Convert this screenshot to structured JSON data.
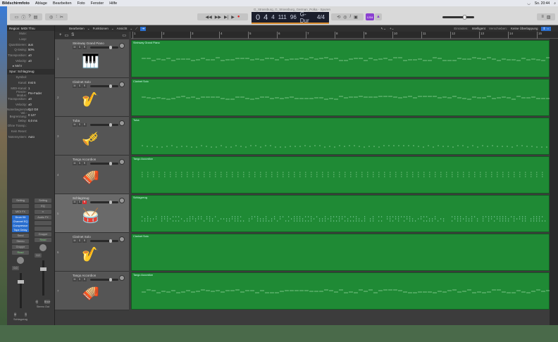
{
  "menubar": {
    "app": "Bildschirmfoto",
    "items": [
      "Ablage",
      "Bearbeiten",
      "Foto",
      "Fenster",
      "Hilfe"
    ],
    "clock": "So. 20:44"
  },
  "window": {
    "title": "G_Strassburg_G_Strassburg_German_Polka - Spuren"
  },
  "lcd": {
    "bar": "0",
    "beat": "4",
    "div": "4",
    "tick": "111",
    "tempo": "96",
    "key": "G-Dur",
    "sig": "4/4"
  },
  "count_in": "1234",
  "control_bar": {
    "edit": "Bearbeiten",
    "functions": "Funktionen",
    "view": "Ansicht",
    "snap_label": "Einrasten:",
    "snap_value": "Intelligent",
    "drag_label": "Verschieben:",
    "drag_value": "Keine Überlappung"
  },
  "ruler": [
    "1",
    "2",
    "3",
    "4",
    "5",
    "6",
    "7",
    "8",
    "9",
    "10",
    "11",
    "12",
    "13",
    "14",
    "15"
  ],
  "inspector": {
    "region_header": "Region: MIDI Thru",
    "region_rows": [
      [
        "Mute:",
        ""
      ],
      [
        "Loop:",
        ""
      ],
      [
        "Quantisieren:",
        "aus"
      ],
      [
        "Q-Swing:",
        "50%"
      ],
      [
        "Transposition:",
        "±0"
      ],
      [
        "Velocity:",
        "±0"
      ]
    ],
    "more": "▸ Mehr",
    "track_header": "Spur: Schlagzeug",
    "track_rows": [
      [
        "Symbol:",
        ""
      ],
      [
        "Kanal:",
        "Inst 5"
      ],
      [
        "MIDI-Kanal:",
        "1"
      ],
      [
        "Freeze-Modus:",
        "Pre-Fader"
      ],
      [
        "Transposition:",
        "±0"
      ],
      [
        "Velocity:",
        "±0"
      ],
      [
        "Notenbegrenzung:",
        "C-2  G8"
      ],
      [
        "Vel.-Begrenzung:",
        "0  127"
      ],
      [
        "Delay:",
        "0,0 ms"
      ],
      [
        "Ohne Transp.:",
        ""
      ],
      [
        "Kein Reset:",
        ""
      ],
      [
        "Notensystem:",
        "Auto"
      ]
    ]
  },
  "strips": [
    {
      "buttons": [
        "Setting",
        "",
        "MIDI FX"
      ],
      "plugins": [
        "Drum Kit",
        "Channel EQ",
        "Compressor",
        "Tape Delay"
      ],
      "after": [
        "Send",
        "Stereo",
        "Gruppe"
      ],
      "auto": "Read",
      "value": "0,0",
      "ms": [
        "M",
        "S"
      ],
      "name": "Schlagzeug"
    },
    {
      "buttons": [
        "Setting",
        "EQ",
        "∞"
      ],
      "plugins": [
        "Audio FX"
      ],
      "after": [
        "",
        "",
        "Gruppe"
      ],
      "auto": "Read",
      "value": "0,0",
      "ms": [
        "M",
        "Bnce"
      ],
      "name": "Stereo Out"
    }
  ],
  "tracks": [
    {
      "num": "1",
      "name": "Steinway Grand Piano",
      "icon": "piano-icon",
      "glyph": "🎹",
      "pattern": "melody"
    },
    {
      "num": "2",
      "name": "Clarinet Solo",
      "icon": "clarinet-icon",
      "glyph": "🎷",
      "pattern": "melody"
    },
    {
      "num": "3",
      "name": "Tuba",
      "icon": "tuba-icon",
      "glyph": "🎺",
      "pattern": "bass"
    },
    {
      "num": "4",
      "name": "Tango Accordion",
      "icon": "accordion-icon",
      "glyph": "🪗",
      "pattern": "chords"
    },
    {
      "num": "5",
      "name": "Schlagzeug",
      "icon": "drum-kit-icon",
      "glyph": "🥁",
      "pattern": "drums",
      "selected": true
    },
    {
      "num": "6",
      "name": "Clarinet Solo",
      "icon": "clarinet-icon",
      "glyph": "🎷",
      "pattern": "empty"
    },
    {
      "num": "7",
      "name": "Tango Accordion",
      "icon": "accordion-icon",
      "glyph": "🪗",
      "pattern": "melody"
    }
  ],
  "colors": {
    "region": "#1f8a35",
    "record": "#e02020",
    "accent": "#2a6fd0"
  }
}
